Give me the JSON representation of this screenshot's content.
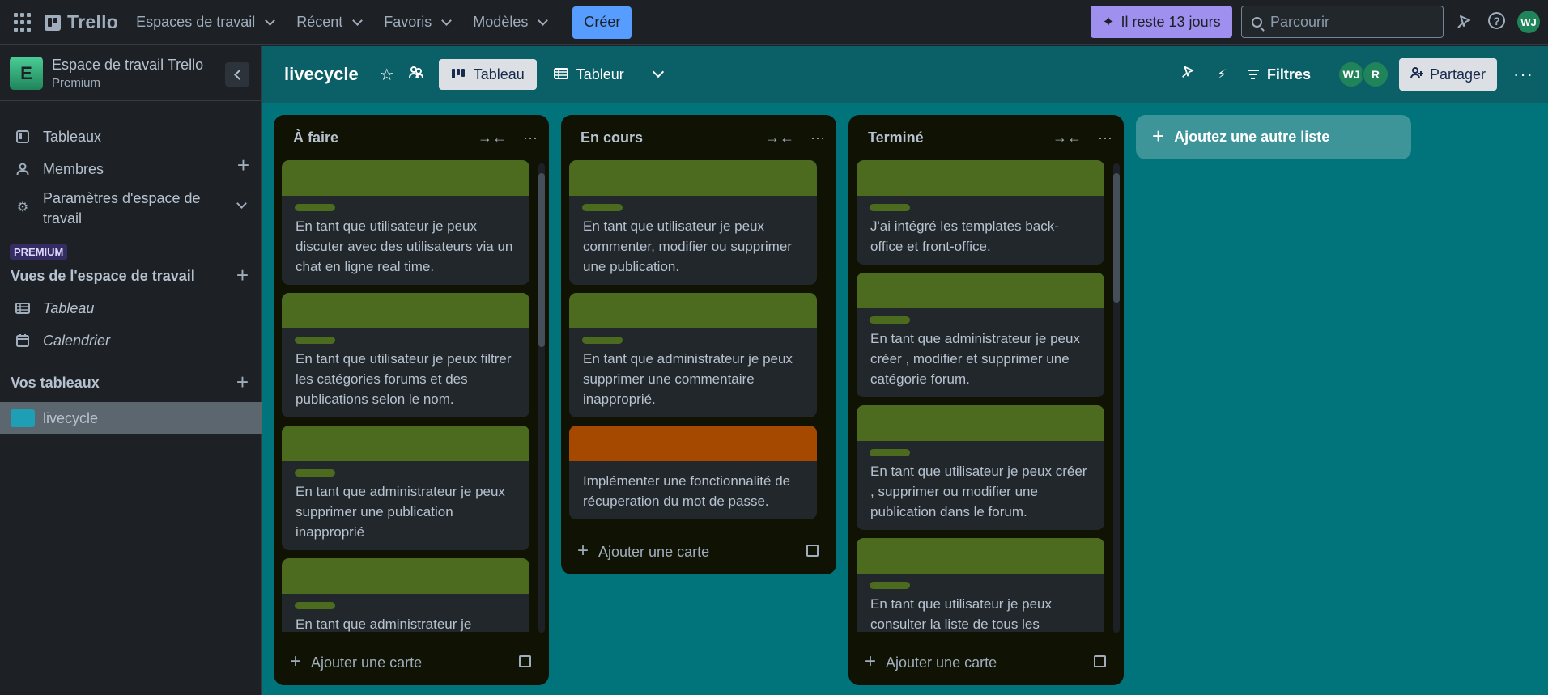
{
  "topbar": {
    "app_name": "Trello",
    "nav": [
      "Espaces de travail",
      "Récent",
      "Favoris",
      "Modèles"
    ],
    "create_label": "Créer",
    "trial_label": "Il reste 13 jours",
    "search_placeholder": "Parcourir",
    "user_initials": "WJ"
  },
  "sidebar": {
    "workspace_initial": "E",
    "workspace_name": "Espace de travail Trello",
    "workspace_plan": "Premium",
    "items": [
      {
        "label": "Tableaux",
        "icon": "board-icon"
      },
      {
        "label": "Membres",
        "icon": "person-icon"
      },
      {
        "label": "Paramètres d'espace de travail",
        "icon": "gear-icon"
      }
    ],
    "premium_badge": "PREMIUM",
    "views_title": "Vues de l'espace de travail",
    "views": [
      {
        "label": "Tableau",
        "icon": "table-icon"
      },
      {
        "label": "Calendrier",
        "icon": "calendar-icon"
      }
    ],
    "boards_title": "Vos tableaux",
    "boards": [
      {
        "label": "livecycle",
        "color": "#1e9fb5"
      }
    ]
  },
  "board": {
    "name": "livecycle",
    "views": [
      "Tableau",
      "Tableur"
    ],
    "filters_label": "Filtres",
    "members": [
      "WJ",
      "R"
    ],
    "share_label": "Partager",
    "add_list_label": "Ajoutez une autre liste",
    "lists": [
      {
        "title": "À faire",
        "add_card_label": "Ajouter une carte",
        "cards": [
          {
            "cover": "#4c6b1f",
            "label": true,
            "text": "En tant que utilisateur je peux discuter avec des utilisateurs via un chat en ligne real time."
          },
          {
            "cover": "#4c6b1f",
            "label": true,
            "text": "En tant que utilisateur je peux filtrer les catégories forums et des publications selon le nom."
          },
          {
            "cover": "#4c6b1f",
            "label": true,
            "text": "En tant que administrateur je peux supprimer une publication inapproprié"
          },
          {
            "cover": "#4c6b1f",
            "label": true,
            "text": "En tant que administrateur je"
          }
        ]
      },
      {
        "title": "En cours",
        "add_card_label": "Ajouter une carte",
        "cards": [
          {
            "cover": "#4c6b1f",
            "label": true,
            "text": "En tant que utilisateur je peux commenter, modifier ou supprimer une publication."
          },
          {
            "cover": "#4c6b1f",
            "label": true,
            "text": "En tant que administrateur je peux supprimer une commentaire inapproprié."
          },
          {
            "cover": "#a54800",
            "label": false,
            "text": "Implémenter une fonctionnalité de récuperation du mot de passe."
          }
        ]
      },
      {
        "title": "Terminé",
        "add_card_label": "Ajouter une carte",
        "cards": [
          {
            "cover": "#4c6b1f",
            "label": true,
            "text": "J'ai intégré les templates back-office et front-office."
          },
          {
            "cover": "#4c6b1f",
            "label": true,
            "text": "En tant que administrateur je peux créer , modifier et supprimer une catégorie forum."
          },
          {
            "cover": "#4c6b1f",
            "label": true,
            "text": "En tant que utilisateur je peux créer , supprimer ou modifier une publication dans le forum."
          },
          {
            "cover": "#4c6b1f",
            "label": true,
            "text": "En tant que utilisateur je peux consulter la liste de tous les"
          }
        ]
      }
    ]
  }
}
